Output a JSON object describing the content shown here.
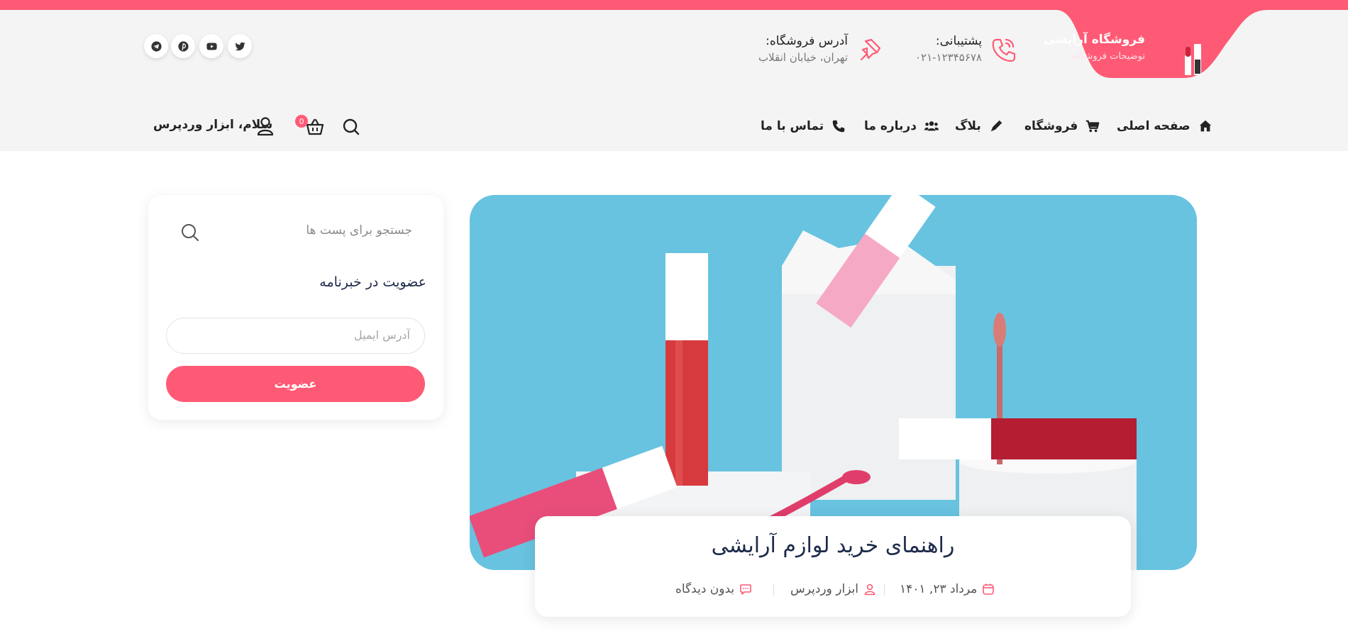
{
  "colors": {
    "accent": "#ff5a75",
    "header_bg": "#f4f4f4",
    "hero_bg": "#68c3e0"
  },
  "store": {
    "name": "فروشگاه آرایشی",
    "description": "توضیحات فروشگاه"
  },
  "support": {
    "title": "پشتیبانی:",
    "phone": "۰۲۱-۱۲۳۴۵۶۷۸",
    "icon": "phone-icon"
  },
  "address": {
    "title": "آدرس فروشگاه:",
    "value": "تهران، خیابان انقلاب",
    "icon": "pin-icon"
  },
  "social": [
    "twitter-icon",
    "youtube-icon",
    "pinterest-icon",
    "telegram-icon"
  ],
  "nav": {
    "items": [
      {
        "label": "صفحه اصلی",
        "icon": "home-icon"
      },
      {
        "label": "فروشگاه",
        "icon": "cart-icon"
      },
      {
        "label": "بلاگ",
        "icon": "pen-icon"
      },
      {
        "label": "درباره ما",
        "icon": "users-icon"
      },
      {
        "label": "تماس با ما",
        "icon": "phone-icon"
      }
    ]
  },
  "header": {
    "cart_count": "0",
    "greeting": "سلام، ابزار وردپرس"
  },
  "sidebar": {
    "search_placeholder": "جستجو برای پست ها",
    "newsletter_title": "عضویت در خبرنامه",
    "email_placeholder": "آدرس ایمیل",
    "join_label": "عضویت"
  },
  "post": {
    "title": "راهنمای خرید لوازم آرایشی",
    "date": "مرداد ۲۳, ۱۴۰۱",
    "author": "ابزار وردپرس",
    "comments": "بدون دیدگاه"
  }
}
